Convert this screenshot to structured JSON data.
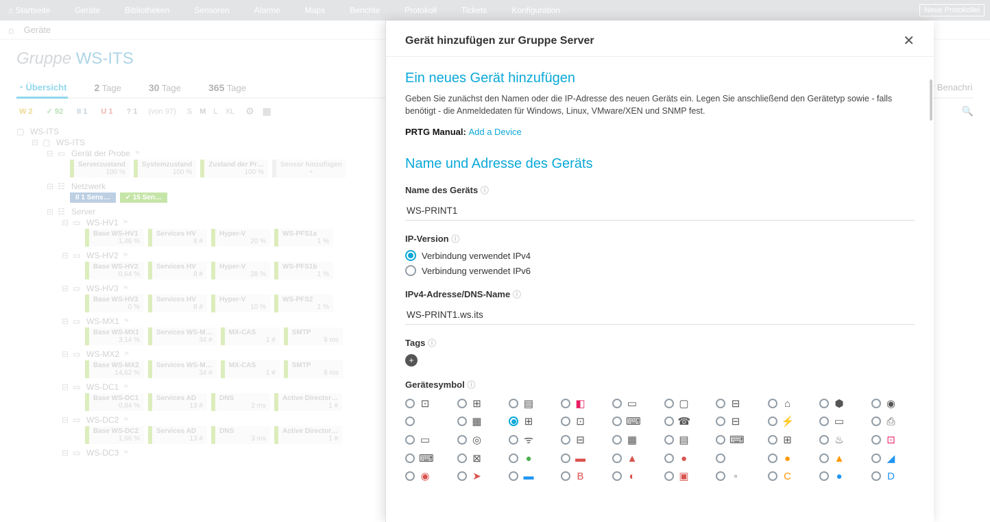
{
  "nav": {
    "items": [
      "Startseite",
      "Geräte",
      "Bibliotheken",
      "Sensoren",
      "Alarme",
      "Maps",
      "Berichte",
      "Protokoll",
      "Tickets",
      "Konfiguration"
    ],
    "new_proto": "Neue Protokollei"
  },
  "crumbs": {
    "home": "⌂",
    "devices": "Geräte"
  },
  "page": {
    "title_prefix": "Gruppe ",
    "title_name": "WS-ITS",
    "tabs": {
      "overview": "Übersicht",
      "d2_num": "2",
      "d2_txt": "Tage",
      "d30_num": "30",
      "d30_txt": "Tage",
      "d365_num": "365",
      "d365_txt": "Tage",
      "notify_right": "für Benachri"
    },
    "toolbar": {
      "w": "W 2",
      "g": "✓ 92",
      "p": "II 1",
      "u": "U 1",
      "q": "? 1",
      "von": "(von 97)",
      "sizes": [
        "S",
        "M",
        "L",
        "XL"
      ]
    }
  },
  "tree": {
    "root": "WS-ITS",
    "root2": "WS-ITS",
    "probe": "Gerät der Probe",
    "probe_sensors": [
      {
        "name": "Serverzustand",
        "val": "100 %"
      },
      {
        "name": "Systemzustand",
        "val": "100 %"
      },
      {
        "name": "Zustand der Pr…",
        "val": "100 %"
      },
      {
        "name": "Sensor hinzufügen",
        "val": "+",
        "add": true
      }
    ],
    "network": "Netzwerk",
    "net_badges": {
      "paused": "II 1 Sens…",
      "ok": "✓ 15 Sen…"
    },
    "server": "Server",
    "hosts": [
      {
        "name": "WS-HV1",
        "sensors": [
          {
            "name": "Base WS-HV1",
            "val": "1,46 %"
          },
          {
            "name": "Services HV",
            "val": "8 #"
          },
          {
            "name": "Hyper-V",
            "val": "20 %"
          },
          {
            "name": "WS-PFS1a",
            "val": "1 %"
          }
        ]
      },
      {
        "name": "WS-HV2",
        "sensors": [
          {
            "name": "Base WS-HV2",
            "val": "0,64 %"
          },
          {
            "name": "Services HV",
            "val": "8 #"
          },
          {
            "name": "Hyper-V",
            "val": "28 %"
          },
          {
            "name": "WS-PFS1b",
            "val": "1 %"
          }
        ]
      },
      {
        "name": "WS-HV3",
        "sensors": [
          {
            "name": "Base WS-HV3",
            "val": "0 %"
          },
          {
            "name": "Services HV",
            "val": "8 #"
          },
          {
            "name": "Hyper-V",
            "val": "10 %"
          },
          {
            "name": "WS-PFS2",
            "val": "1 %"
          }
        ]
      },
      {
        "name": "WS-MX1",
        "sensors": [
          {
            "name": "Base WS-MX1",
            "val": "3,14 %"
          },
          {
            "name": "Services WS-M…",
            "val": "34 #"
          },
          {
            "name": "MX-CAS",
            "val": "1 #"
          },
          {
            "name": "SMTP",
            "val": "9 ms"
          }
        ]
      },
      {
        "name": "WS-MX2",
        "sensors": [
          {
            "name": "Base WS-MX2",
            "val": "14,62 %"
          },
          {
            "name": "Services WS-M…",
            "val": "34 #"
          },
          {
            "name": "MX-CAS",
            "val": "1 #"
          },
          {
            "name": "SMTP",
            "val": "9 ms"
          }
        ]
      },
      {
        "name": "WS-DC1",
        "sensors": [
          {
            "name": "Base WS-DC1",
            "val": "0,84 %"
          },
          {
            "name": "Services AD",
            "val": "13 #"
          },
          {
            "name": "DNS",
            "val": "2 ms"
          },
          {
            "name": "Active Director…",
            "val": "1 #"
          }
        ]
      },
      {
        "name": "WS-DC2",
        "sensors": [
          {
            "name": "Base WS-DC2",
            "val": "1,66 %"
          },
          {
            "name": "Services AD",
            "val": "13 #"
          },
          {
            "name": "DNS",
            "val": "3 ms"
          },
          {
            "name": "Active Director…",
            "val": "1 #"
          }
        ]
      },
      {
        "name": "WS-DC3",
        "sensors": []
      }
    ]
  },
  "modal": {
    "title": "Gerät hinzufügen zur Gruppe Server",
    "h_add": "Ein neues Gerät hinzufügen",
    "desc": "Geben Sie zunächst den Namen oder die IP-Adresse des neuen Geräts ein. Legen Sie anschließend den Gerätetyp sowie - falls benötigt - die Anmeldedaten für Windows, Linux, VMware/XEN und SNMP fest.",
    "manual_prefix": "PRTG Manual: ",
    "manual_link": "Add a Device",
    "h_name": "Name und Adresse des Geräts",
    "lbl_name": "Name des Geräts",
    "val_name": "WS-PRINT1",
    "lbl_ipver": "IP-Version",
    "radio_ipv4": "Verbindung verwendet IPv4",
    "radio_ipv6": "Verbindung verwendet IPv6",
    "lbl_addr": "IPv4-Adresse/DNS-Name",
    "val_addr": "WS-PRINT1.ws.its",
    "lbl_tags": "Tags",
    "lbl_symbol": "Gerätesymbol",
    "icons_row1": [
      "⊡",
      "⊞",
      "▤",
      "◧",
      "▭",
      "▢",
      "⊟",
      "⌂",
      "⬢",
      "◉"
    ],
    "icons_row2": [
      "",
      "▦",
      "⊞",
      "⊡",
      "⌨",
      "☎",
      "⊟",
      "⚡",
      "▭",
      "⎙"
    ],
    "icons_row3": [
      "▭",
      "◎",
      "ᯤ",
      "⊟",
      "▦",
      "▤",
      "⌨",
      "⊞",
      "♨",
      "⊡"
    ],
    "icons_row4": [
      "⌨",
      "⊠",
      "●",
      "▬",
      "▲",
      "●",
      "",
      "●",
      "▲",
      "◢"
    ],
    "icons_row5": [
      "◉",
      "➤",
      "▬",
      "B",
      "◐",
      "▣",
      "◦",
      "C",
      "●",
      "D"
    ]
  }
}
